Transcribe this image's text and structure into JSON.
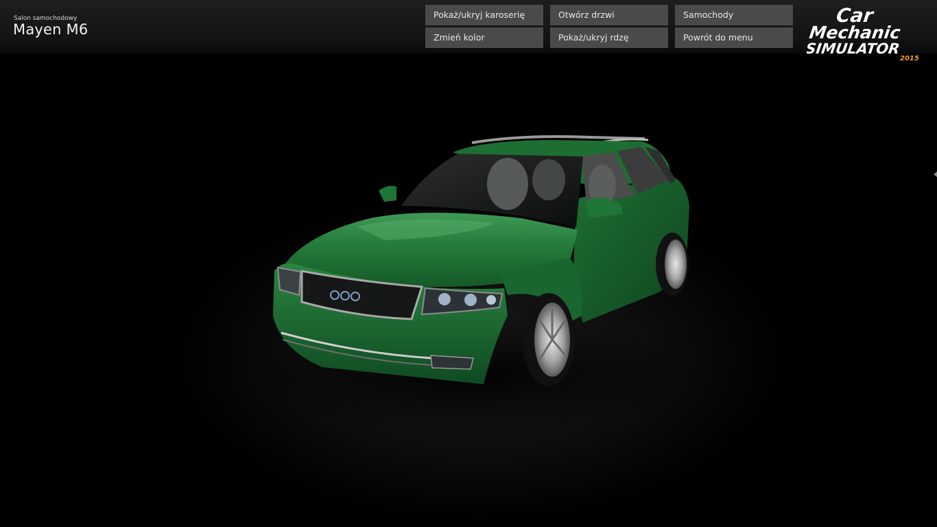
{
  "header": {
    "subtitle": "Salon samochodowy",
    "title": "Mayen M6"
  },
  "menu": {
    "toggle_body": "Pokaż/ukryj karoserię",
    "open_doors": "Otwórz drzwi",
    "cars": "Samochody",
    "change_color": "Zmień kolor",
    "toggle_rust": "Pokaż/ukryj rdzę",
    "back_to_menu": "Powrót do menu"
  },
  "logo": {
    "line1": "Car",
    "line2": "Mechanic",
    "line3": "SIMULATOR",
    "year": "2015"
  },
  "colors": {
    "car_paint": "#1e6b2f",
    "button_bg": "#4a4a4a",
    "logo_year": "#f0a020"
  }
}
